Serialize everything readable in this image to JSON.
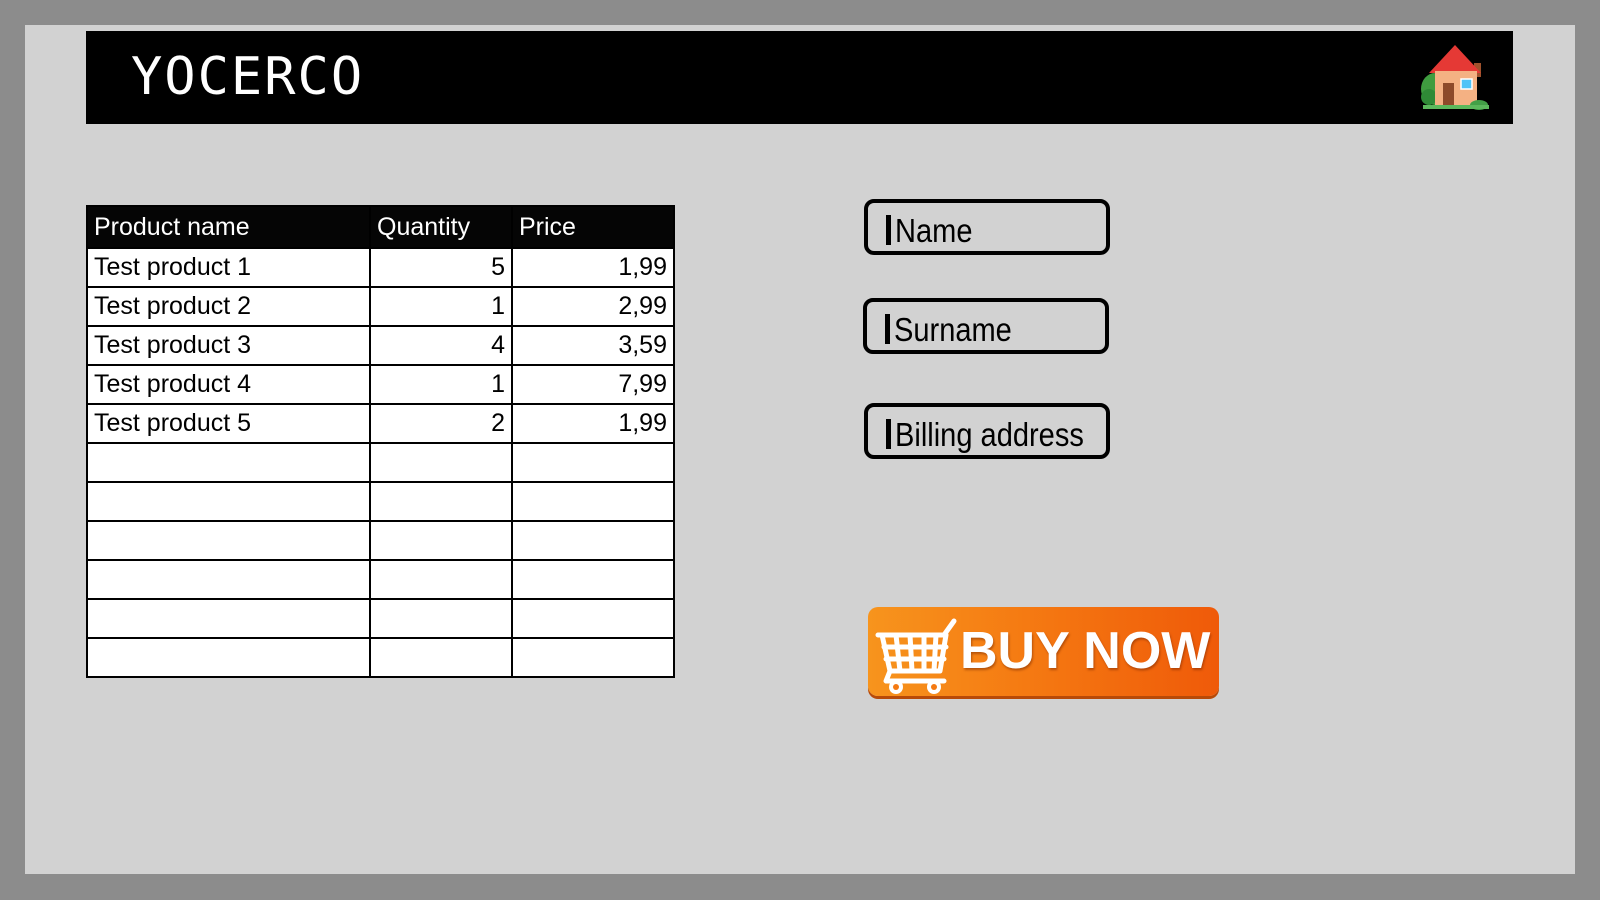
{
  "header": {
    "brand": "YOCERCO",
    "home_icon": "house-icon"
  },
  "table": {
    "columns": [
      "Product name",
      "Quantity",
      "Price"
    ],
    "rows": [
      {
        "name": "Test product 1",
        "quantity": "5",
        "price": "1,99"
      },
      {
        "name": "Test product 2",
        "quantity": "1",
        "price": "2,99"
      },
      {
        "name": "Test product 3",
        "quantity": "4",
        "price": "3,59"
      },
      {
        "name": "Test product 4",
        "quantity": "1",
        "price": "7,99"
      },
      {
        "name": "Test product 5",
        "quantity": "2",
        "price": "1,99"
      }
    ],
    "empty_rows": 6
  },
  "form": {
    "name_placeholder": "Name",
    "surname_placeholder": "Surname",
    "billing_placeholder": "Billing address"
  },
  "buy_button": {
    "label": "BUY NOW",
    "icon": "shopping-cart-icon",
    "color_start": "#f7941d",
    "color_end": "#ef5a09"
  }
}
